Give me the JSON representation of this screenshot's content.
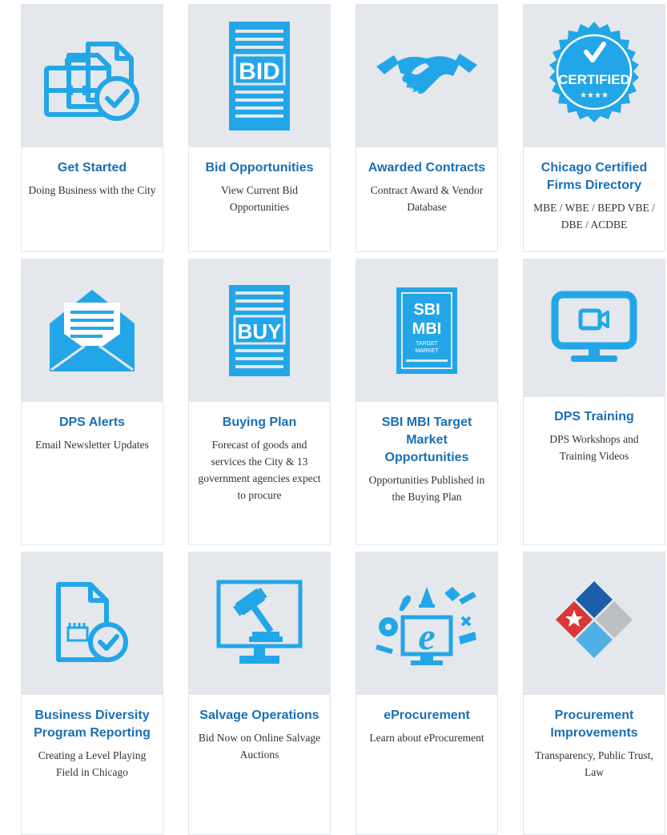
{
  "colors": {
    "icon_blue": "#23a6e8",
    "title_blue": "#1a6fb4",
    "tile_bg": "#e4e8ec",
    "card_border": "#e2e6ea"
  },
  "cards": [
    {
      "title": "Get Started",
      "desc": "Doing Business with the City",
      "icon": "briefcase-document-check-icon"
    },
    {
      "title": "Bid Opportunities",
      "desc": "View Current Bid Opportunities",
      "icon": "bid-document-icon",
      "icon_text": "BID"
    },
    {
      "title": "Awarded Contracts",
      "desc": "Contract Award & Vendor Database",
      "icon": "handshake-icon"
    },
    {
      "title": "Chicago Certified Firms Directory",
      "desc": "MBE / WBE / BEPD VBE / DBE / ACDBE",
      "icon": "certified-seal-icon",
      "icon_text": "CERTIFIED",
      "icon_stars": "★★★★"
    },
    {
      "title": "DPS Alerts",
      "desc": "Email Newsletter Updates",
      "icon": "envelope-icon"
    },
    {
      "title": "Buying Plan",
      "desc": "Forecast of goods and services the City & 13 government agencies expect to procure",
      "icon": "buy-document-icon",
      "icon_text": "BUY"
    },
    {
      "title": "SBI MBI Target Market Opportunities",
      "desc": "Opportunities Published in the Buying Plan",
      "icon": "sbi-mbi-document-icon",
      "icon_text_1": "SBI",
      "icon_text_2": "MBI",
      "icon_text_3": "TARGET",
      "icon_text_4": "MARKET"
    },
    {
      "title": "DPS Training",
      "desc": "DPS Workshops and Training Videos",
      "icon": "video-monitor-icon"
    },
    {
      "title": "Business Diversity Program Reporting",
      "desc": "Creating a Level Playing Field in Chicago",
      "icon": "report-document-check-icon"
    },
    {
      "title": "Salvage Operations",
      "desc": "Bid Now on Online Salvage Auctions",
      "icon": "auction-gavel-monitor-icon"
    },
    {
      "title": "eProcurement",
      "desc": "Learn about eProcurement",
      "icon": "eprocurement-icon"
    },
    {
      "title": "Procurement Improvements",
      "desc": "Transparency, Public Trust, Law",
      "icon": "diamond-logo-icon"
    }
  ]
}
